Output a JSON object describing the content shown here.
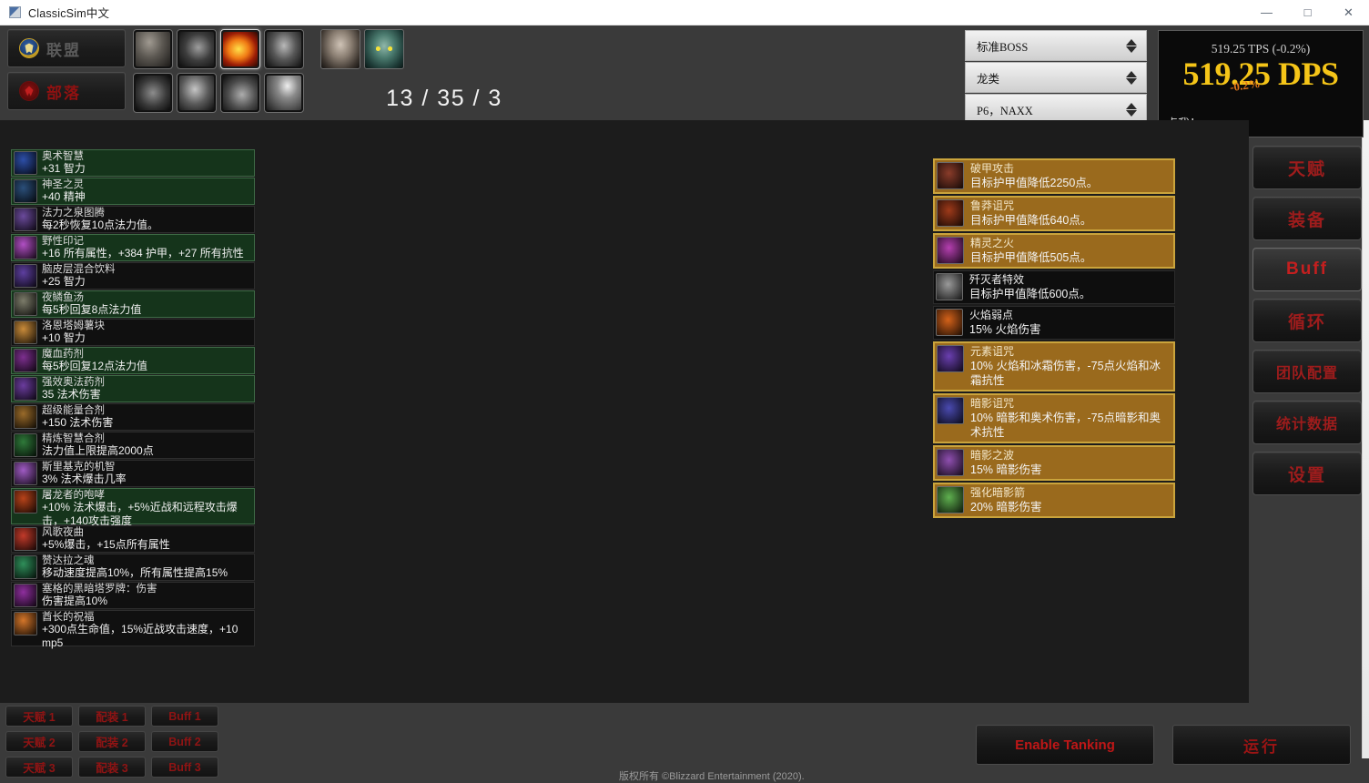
{
  "window": {
    "title": "ClassicSim中文",
    "app_icon": "app-icon",
    "minimize": "—",
    "maximize": "□",
    "close": "✕"
  },
  "topbar": {
    "factions": [
      {
        "id": "alliance",
        "label": "联盟",
        "icon": "alliance-crest-icon",
        "selected": false
      },
      {
        "id": "horde",
        "label": "部落",
        "icon": "horde-crest-icon",
        "selected": false
      }
    ],
    "class_icons": [
      {
        "name": "warrior-icon",
        "glyph": "g-warrior",
        "selected": false
      },
      {
        "name": "hunter-icon",
        "glyph": "g-hunter",
        "selected": false
      },
      {
        "name": "mage-icon",
        "glyph": "g-mage",
        "selected": true
      },
      {
        "name": "rogue-icon",
        "glyph": "g-rogue",
        "selected": false
      },
      {
        "name": "priest-icon",
        "glyph": "g-priest",
        "selected": false
      },
      {
        "name": "shaman-icon",
        "glyph": "g-shaman",
        "selected": false
      },
      {
        "name": "druid-icon",
        "glyph": "g-druid",
        "selected": false
      },
      {
        "name": "paladin-icon",
        "glyph": "g-paladin",
        "selected": false
      }
    ],
    "race_icons": [
      {
        "name": "race-human-icon",
        "glyph": "r-human"
      },
      {
        "name": "race-nightelf-icon",
        "glyph": "r-nightelf"
      }
    ],
    "talent_counter": "13 / 35 / 3"
  },
  "selectors": [
    {
      "name": "boss-type-select",
      "value": "标准BOSS"
    },
    {
      "name": "creature-type-select",
      "value": "龙类"
    },
    {
      "name": "phase-select",
      "value": "P6，NAXX"
    }
  ],
  "dps_panel": {
    "tps_line": "519.25 TPS (-0.2%)",
    "dps_value": "519.25 DPS",
    "dps_delta_overlay": "-0.2%",
    "click_hint": "点我！"
  },
  "buffs": [
    {
      "name": "奥术智慧",
      "desc": "+31 智力",
      "on": true,
      "icon_color": "#2d4fa8",
      "tall": false
    },
    {
      "name": "神圣之灵",
      "desc": "+40 精神",
      "on": true,
      "icon_color": "#2b4f7a",
      "tall": false
    },
    {
      "name": "法力之泉图腾",
      "desc": "每2秒恢复10点法力值。",
      "on": false,
      "icon_color": "#6b4a9c",
      "tall": false
    },
    {
      "name": "野性印记",
      "desc": "+16 所有属性，+384 护甲，+27 所有抗性",
      "on": true,
      "icon_color": "#b14fc4",
      "tall": false
    },
    {
      "name": "脑皮层混合饮料",
      "desc": "+25 智力",
      "on": false,
      "icon_color": "#5e3fa0",
      "tall": false
    },
    {
      "name": "夜鳞鱼汤",
      "desc": "每5秒回复8点法力值",
      "on": true,
      "icon_color": "#7c7c6a",
      "tall": false
    },
    {
      "name": "洛恩塔姆薯块",
      "desc": "+10 智力",
      "on": false,
      "icon_color": "#c98b3a",
      "tall": false
    },
    {
      "name": "魔血药剂",
      "desc": "每5秒回复12点法力值",
      "on": true,
      "icon_color": "#7d2f8f",
      "tall": false
    },
    {
      "name": "强效奥法药剂",
      "desc": "35 法术伤害",
      "on": true,
      "icon_color": "#6b3c9e",
      "tall": false
    },
    {
      "name": "超级能量合剂",
      "desc": "+150 法术伤害",
      "on": false,
      "icon_color": "#9a6b2a",
      "tall": false
    },
    {
      "name": "精炼智慧合剂",
      "desc": "法力值上限提高2000点",
      "on": false,
      "icon_color": "#2f7a3a",
      "tall": false
    },
    {
      "name": "斯里基克的机智",
      "desc": "3% 法术爆击几率",
      "on": false,
      "icon_color": "#a05bc4",
      "tall": false
    },
    {
      "name": "屠龙者的咆哮",
      "desc": "+10% 法术爆击，+5%近战和远程攻击爆击，+140攻击强度",
      "on": true,
      "icon_color": "#b8431a",
      "tall": true
    },
    {
      "name": "风歌夜曲",
      "desc": "+5%爆击，+15点所有属性",
      "on": false,
      "icon_color": "#c23a2a",
      "tall": false
    },
    {
      "name": "赞达拉之魂",
      "desc": "移动速度提高10%，所有属性提高15%",
      "on": false,
      "icon_color": "#2f8f5a",
      "tall": false
    },
    {
      "name": "塞格的黑暗塔罗牌：伤害",
      "desc": "伤害提高10%",
      "on": false,
      "icon_color": "#8f2f9e",
      "tall": false
    },
    {
      "name": "酋长的祝福",
      "desc": "+300点生命值，15%近战攻击速度，+10 mp5",
      "on": false,
      "icon_color": "#d4762a",
      "tall": true
    }
  ],
  "debuffs": [
    {
      "name": "破甲攻击",
      "desc": "目标护甲值降低2250点。",
      "on": true,
      "icon_color": "#8a3c2a"
    },
    {
      "name": "鲁莽诅咒",
      "desc": "目标护甲值降低640点。",
      "on": true,
      "icon_color": "#9e3a1a"
    },
    {
      "name": "精灵之火",
      "desc": "目标护甲值降低505点。",
      "on": true,
      "icon_color": "#b53fb0"
    },
    {
      "name": "歼灭者特效",
      "desc": "目标护甲值降低600点。",
      "on": false,
      "icon_color": "#9a9a9a"
    },
    {
      "name": "火焰弱点",
      "desc": "15% 火焰伤害",
      "on": false,
      "icon_color": "#d4621a"
    },
    {
      "name": "元素诅咒",
      "desc": "10% 火焰和冰霜伤害，-75点火焰和冰霜抗性",
      "on": true,
      "icon_color": "#6a3fb0"
    },
    {
      "name": "暗影诅咒",
      "desc": "10% 暗影和奥术伤害，-75点暗影和奥术抗性",
      "on": true,
      "icon_color": "#4a4ab0"
    },
    {
      "name": "暗影之波",
      "desc": "15% 暗影伤害",
      "on": true,
      "icon_color": "#8f4fb0"
    },
    {
      "name": "强化暗影箭",
      "desc": "20% 暗影伤害",
      "on": true,
      "icon_color": "#5fb04f"
    }
  ],
  "nav_buttons": [
    {
      "name": "nav-talents",
      "label": "天赋",
      "active": false,
      "small": false
    },
    {
      "name": "nav-gear",
      "label": "装备",
      "active": false,
      "small": false
    },
    {
      "name": "nav-buff",
      "label": "Buff",
      "active": true,
      "small": false
    },
    {
      "name": "nav-rotation",
      "label": "循环",
      "active": false,
      "small": false
    },
    {
      "name": "nav-raid-setup",
      "label": "团队配置",
      "active": false,
      "small": true
    },
    {
      "name": "nav-statistics",
      "label": "统计数据",
      "active": false,
      "small": true
    },
    {
      "name": "nav-settings",
      "label": "设置",
      "active": false,
      "small": false
    }
  ],
  "presets": [
    [
      "天赋 1",
      "配装 1",
      "Buff 1"
    ],
    [
      "天赋 2",
      "配装 2",
      "Buff 2"
    ],
    [
      "天赋 3",
      "配装 3",
      "Buff 3"
    ]
  ],
  "footer": {
    "enable_tanking": "Enable Tanking",
    "run": "运行",
    "copyright": "版权所有 ©Blizzard Entertainment (2020)."
  }
}
